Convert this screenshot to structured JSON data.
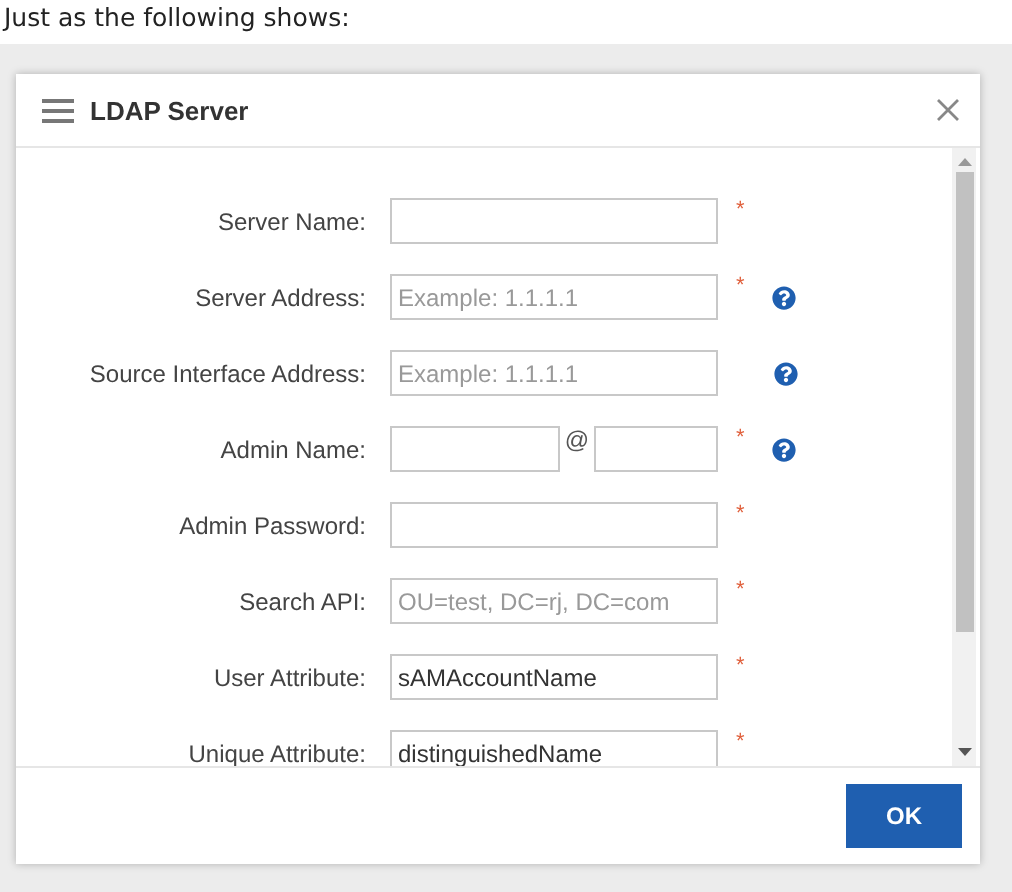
{
  "caption": "Just as the following shows:",
  "dialog": {
    "title": "LDAP Server",
    "fields": [
      {
        "kind": "text",
        "label": "Server Name:",
        "required_mark": "*",
        "help": false
      },
      {
        "kind": "text",
        "label": "Server Address:",
        "placeholder": "Example: 1.1.1.1",
        "required_mark": "*",
        "help": true
      },
      {
        "kind": "text",
        "label": "Source Interface Address:",
        "placeholder": "Example: 1.1.1.1",
        "help": true
      },
      {
        "kind": "split",
        "label": "Admin Name:",
        "separator": "@",
        "required_mark": "*",
        "help": true
      },
      {
        "kind": "text",
        "label": "Admin Password:",
        "required_mark": "*",
        "help": false
      },
      {
        "kind": "text",
        "label": "Search API:",
        "placeholder": "OU=test, DC=rj, DC=com",
        "required_mark": "*",
        "help": false
      },
      {
        "kind": "text",
        "label": "User Attribute:",
        "value": "sAMAccountName",
        "required_mark": "*",
        "help": false
      },
      {
        "kind": "text",
        "label": "Unique Attribute:",
        "value": "distinguishedName",
        "required_mark": "*",
        "help": false
      }
    ],
    "button": "OK"
  }
}
